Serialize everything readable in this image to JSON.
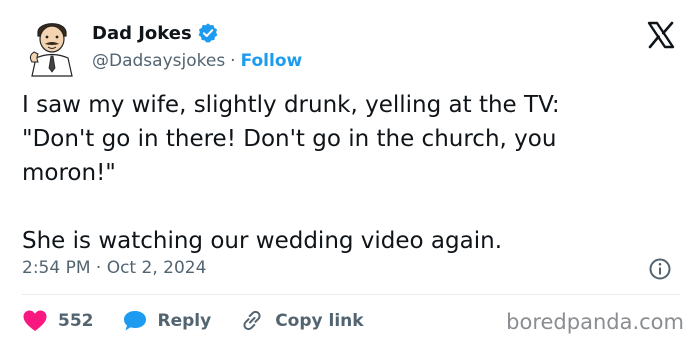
{
  "author": {
    "display_name": "Dad Jokes",
    "handle": "@Dadsaysjokes",
    "separator": "·",
    "follow_label": "Follow",
    "verified": true
  },
  "icons": {
    "avatar": "cartoon-dad-avatar",
    "verified": "verified-badge-icon",
    "platform": "x-logo-icon",
    "info": "info-icon",
    "like": "heart-icon",
    "reply": "speech-bubble-icon",
    "copy_link": "link-icon"
  },
  "tweet": {
    "text": "I saw my wife, slightly drunk, yelling at the TV:\n\"Don't go in there! Don't go in the church, you\nmoron!\"\n\nShe is watching our wedding video again.",
    "timestamp": "2:54 PM · Oct 2, 2024"
  },
  "actions": {
    "like_count": "552",
    "reply_label": "Reply",
    "copy_link_label": "Copy link"
  },
  "watermark": "boredpanda.com",
  "colors": {
    "text": "#0f1419",
    "muted": "#536471",
    "accent": "#1d9bf0",
    "like": "#f91880",
    "watermark": "#8a8d91"
  }
}
